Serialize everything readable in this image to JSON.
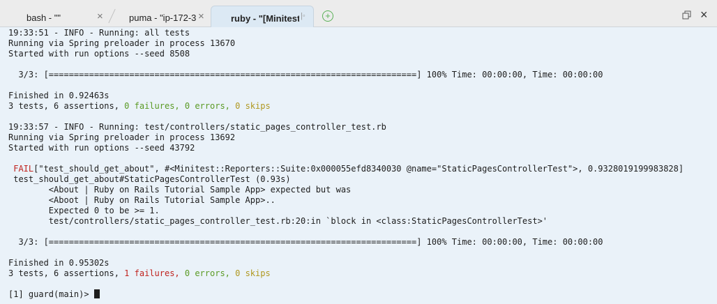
{
  "tabs": [
    {
      "label": "bash - \"\"",
      "close": "×"
    },
    {
      "label": "puma - \"ip-172-3",
      "close": "×"
    },
    {
      "label": "ruby - \"[Minitest",
      "close": "|◦"
    }
  ],
  "new_tab": "+",
  "window": {
    "close": "×"
  },
  "terminal": {
    "l1": "19:33:51 - INFO - Running: all tests",
    "l2": "Running via Spring preloader in process 13670",
    "l3": "Started with run options --seed 8508",
    "l4": "",
    "l5": "  3/3: [=========================================================================] 100% Time: 00:00:00, Time: 00:00:00",
    "l6": "",
    "l7": "Finished in 0.92463s",
    "l8a": "3 tests, 6 assertions, ",
    "l8b": "0 failures, 0 errors, ",
    "l8c": "0 skips",
    "l9": "",
    "l10": "19:33:57 - INFO - Running: test/controllers/static_pages_controller_test.rb",
    "l11": "Running via Spring preloader in process 13692",
    "l12": "Started with run options --seed 43792",
    "l13": "",
    "l14a": " FAIL",
    "l14b": "[\"test_should_get_about\", #<Minitest::Reporters::Suite:0x000055efd8340030 @name=\"StaticPagesControllerTest\">, 0.9328019199983828]",
    "l15": " test_should_get_about#StaticPagesControllerTest (0.93s)",
    "l16": "        <About | Ruby on Rails Tutorial Sample App> expected but was",
    "l17": "        <Aboot | Ruby on Rails Tutorial Sample App>..",
    "l18": "        Expected 0 to be >= 1.",
    "l19": "        test/controllers/static_pages_controller_test.rb:20:in `block in <class:StaticPagesControllerTest>'",
    "l20": "",
    "l21": "  3/3: [=========================================================================] 100% Time: 00:00:00, Time: 00:00:00",
    "l22": "",
    "l23": "Finished in 0.95302s",
    "l24a": "3 tests, 6 assertions, ",
    "l24b": "1 failures, ",
    "l24c": "0 errors, ",
    "l24d": "0 skips",
    "l25": "",
    "l26": "[1] guard(main)> "
  }
}
